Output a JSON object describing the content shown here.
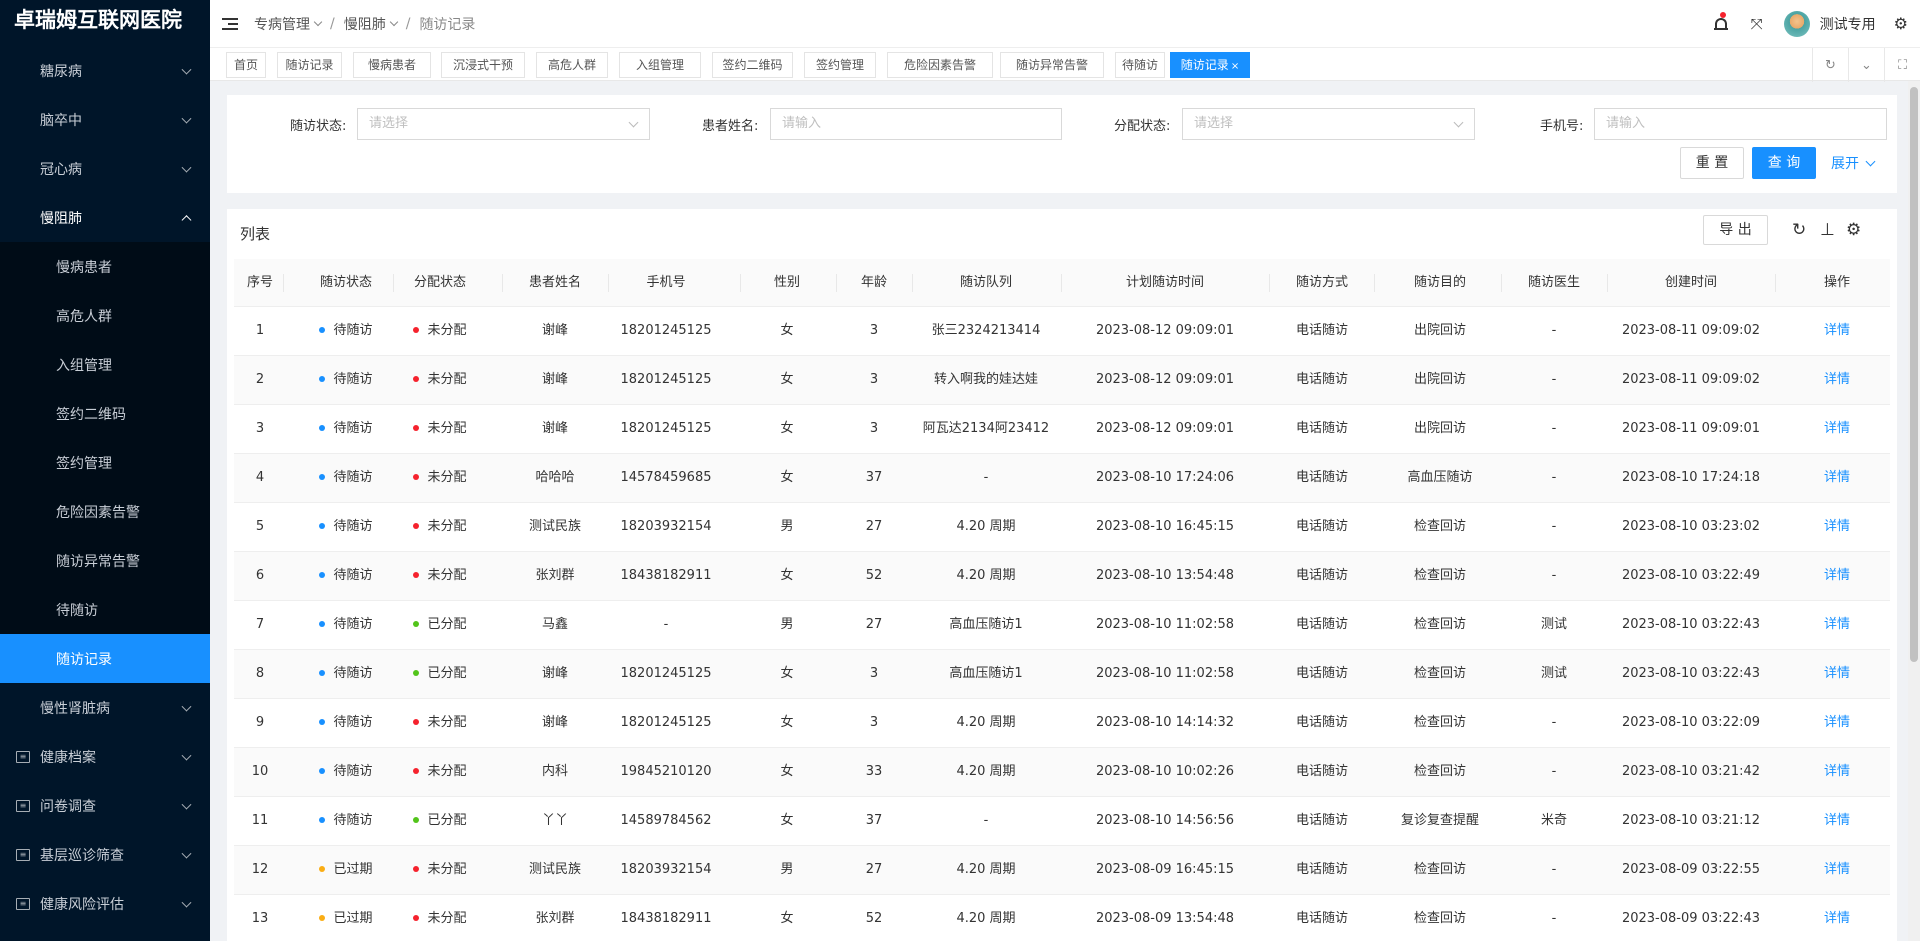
{
  "brand": "卓瑞姆互联网医院",
  "sidebar": {
    "items": [
      {
        "label": "糖尿病",
        "level": "top",
        "chevron": "down"
      },
      {
        "label": "脑卒中",
        "level": "top",
        "chevron": "down"
      },
      {
        "label": "冠心病",
        "level": "top",
        "chevron": "down"
      },
      {
        "label": "慢阻肺",
        "level": "top",
        "chevron": "up"
      },
      {
        "label": "慢病患者",
        "level": "sub"
      },
      {
        "label": "高危人群",
        "level": "sub"
      },
      {
        "label": "入组管理",
        "level": "sub"
      },
      {
        "label": "签约二维码",
        "level": "sub"
      },
      {
        "label": "签约管理",
        "level": "sub"
      },
      {
        "label": "危险因素告警",
        "level": "sub"
      },
      {
        "label": "随访异常告警",
        "level": "sub"
      },
      {
        "label": "待随访",
        "level": "sub"
      },
      {
        "label": "随访记录",
        "level": "sub",
        "active": true
      },
      {
        "label": "慢性肾脏病",
        "level": "top",
        "chevron": "down"
      },
      {
        "label": "健康档案",
        "level": "top",
        "chevron": "down",
        "icon": "doc-icon"
      },
      {
        "label": "问卷调查",
        "level": "top",
        "chevron": "down",
        "icon": "doc-icon"
      },
      {
        "label": "基层巡诊筛查",
        "level": "top",
        "chevron": "down",
        "icon": "doc-icon"
      },
      {
        "label": "健康风险评估",
        "level": "top",
        "chevron": "down",
        "icon": "doc-icon"
      }
    ]
  },
  "header": {
    "breadcrumb": [
      "专病管理",
      "慢阻肺",
      "随访记录"
    ],
    "username": "测试专用"
  },
  "tabs": [
    {
      "label": "首页"
    },
    {
      "label": "随访记录"
    },
    {
      "label": "慢病患者"
    },
    {
      "label": "沉浸式干预"
    },
    {
      "label": "高危人群"
    },
    {
      "label": "入组管理"
    },
    {
      "label": "签约二维码"
    },
    {
      "label": "签约管理"
    },
    {
      "label": "危险因素告警"
    },
    {
      "label": "随访异常告警"
    },
    {
      "label": "待随访"
    },
    {
      "label": "随访记录",
      "active": true,
      "close": "×"
    }
  ],
  "filter": {
    "status_label": "随访状态:",
    "status_placeholder": "请选择",
    "name_label": "患者姓名:",
    "name_placeholder": "请输入",
    "assign_label": "分配状态:",
    "assign_placeholder": "请选择",
    "phone_label": "手机号:",
    "phone_placeholder": "请输入",
    "reset_label": "重 置",
    "query_label": "查 询",
    "expand_label": "展开"
  },
  "list": {
    "title": "列表",
    "export_label": "导 出",
    "columns": [
      "序号",
      "随访状态",
      "分配状态",
      "患者姓名",
      "手机号",
      "性别",
      "年龄",
      "随访队列",
      "计划随访时间",
      "随访方式",
      "随访目的",
      "随访医生",
      "创建时间",
      "操作"
    ],
    "rows": [
      [
        "1",
        "待随访",
        "未分配",
        "谢峰",
        "18201245125",
        "女",
        "3",
        "张三2324213414",
        "2023-08-12 09:09:01",
        "电话随访",
        "出院回访",
        "-",
        "2023-08-11 09:09:02",
        "详情"
      ],
      [
        "2",
        "待随访",
        "未分配",
        "谢峰",
        "18201245125",
        "女",
        "3",
        "转入啊我的娃达娃",
        "2023-08-12 09:09:01",
        "电话随访",
        "出院回访",
        "-",
        "2023-08-11 09:09:02",
        "详情"
      ],
      [
        "3",
        "待随访",
        "未分配",
        "谢峰",
        "18201245125",
        "女",
        "3",
        "阿瓦达2134阿23412",
        "2023-08-12 09:09:01",
        "电话随访",
        "出院回访",
        "-",
        "2023-08-11 09:09:01",
        "详情"
      ],
      [
        "4",
        "待随访",
        "未分配",
        "哈哈哈",
        "14578459685",
        "女",
        "37",
        "-",
        "2023-08-10 17:24:06",
        "电话随访",
        "高血压随访",
        "-",
        "2023-08-10 17:24:18",
        "详情"
      ],
      [
        "5",
        "待随访",
        "未分配",
        "测试民族",
        "18203932154",
        "男",
        "27",
        "4.20 周期",
        "2023-08-10 16:45:15",
        "电话随访",
        "检查回访",
        "-",
        "2023-08-10 03:23:02",
        "详情"
      ],
      [
        "6",
        "待随访",
        "未分配",
        "张刘群",
        "18438182911",
        "女",
        "52",
        "4.20 周期",
        "2023-08-10 13:54:48",
        "电话随访",
        "检查回访",
        "-",
        "2023-08-10 03:22:49",
        "详情"
      ],
      [
        "7",
        "待随访",
        "已分配",
        "马鑫",
        "-",
        "男",
        "27",
        "高血压随访1",
        "2023-08-10 11:02:58",
        "电话随访",
        "检查回访",
        "测试",
        "2023-08-10 03:22:43",
        "详情"
      ],
      [
        "8",
        "待随访",
        "已分配",
        "谢峰",
        "18201245125",
        "女",
        "3",
        "高血压随访1",
        "2023-08-10 11:02:58",
        "电话随访",
        "检查回访",
        "测试",
        "2023-08-10 03:22:43",
        "详情"
      ],
      [
        "9",
        "待随访",
        "未分配",
        "谢峰",
        "18201245125",
        "女",
        "3",
        "4.20 周期",
        "2023-08-10 14:14:32",
        "电话随访",
        "检查回访",
        "-",
        "2023-08-10 03:22:09",
        "详情"
      ],
      [
        "10",
        "待随访",
        "未分配",
        "内科",
        "19845210120",
        "女",
        "33",
        "4.20 周期",
        "2023-08-10 10:02:26",
        "电话随访",
        "检查回访",
        "-",
        "2023-08-10 03:21:42",
        "详情"
      ],
      [
        "11",
        "待随访",
        "已分配",
        "丫丫",
        "14589784562",
        "女",
        "37",
        "-",
        "2023-08-10 14:56:56",
        "电话随访",
        "复诊复查提醒",
        "米奇",
        "2023-08-10 03:21:12",
        "详情"
      ],
      [
        "12",
        "已过期",
        "未分配",
        "测试民族",
        "18203932154",
        "男",
        "27",
        "4.20 周期",
        "2023-08-09 16:45:15",
        "电话随访",
        "检查回访",
        "-",
        "2023-08-09 03:22:55",
        "详情"
      ],
      [
        "13",
        "已过期",
        "未分配",
        "张刘群",
        "18438182911",
        "女",
        "52",
        "4.20 周期",
        "2023-08-09 13:54:48",
        "电话随访",
        "检查回访",
        "-",
        "2023-08-09 03:22:43",
        "详情"
      ]
    ]
  },
  "colors": {
    "primary": "#1890ff",
    "sidebar_bg": "#001529",
    "status_pending": "#1890ff",
    "status_expired": "#faad14",
    "assign_none": "#f5222d",
    "assign_done": "#52c41a"
  }
}
